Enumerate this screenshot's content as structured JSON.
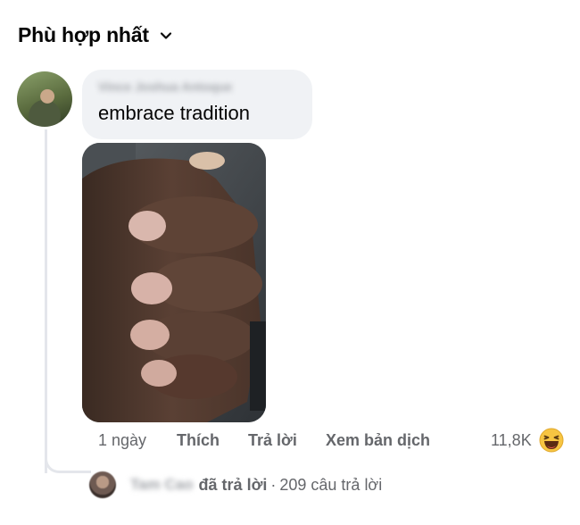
{
  "sort": {
    "label": "Phù hợp nhất"
  },
  "comment": {
    "author": "Vince Joshua Antoque",
    "text": "embrace tradition",
    "time": "1 ngày",
    "actions": {
      "like": "Thích",
      "reply": "Trả lời",
      "translate": "Xem bản dịch"
    },
    "reactions": {
      "count": "11,8K",
      "icon": "haha-emoji"
    }
  },
  "reply_summary": {
    "name": "Tam Cao",
    "action": "đã trả lời",
    "separator": "·",
    "count": "209 câu trả lời"
  },
  "colors": {
    "meta_text": "#65676b",
    "bubble_bg": "#f0f2f5",
    "thread_line": "#e4e6eb"
  }
}
